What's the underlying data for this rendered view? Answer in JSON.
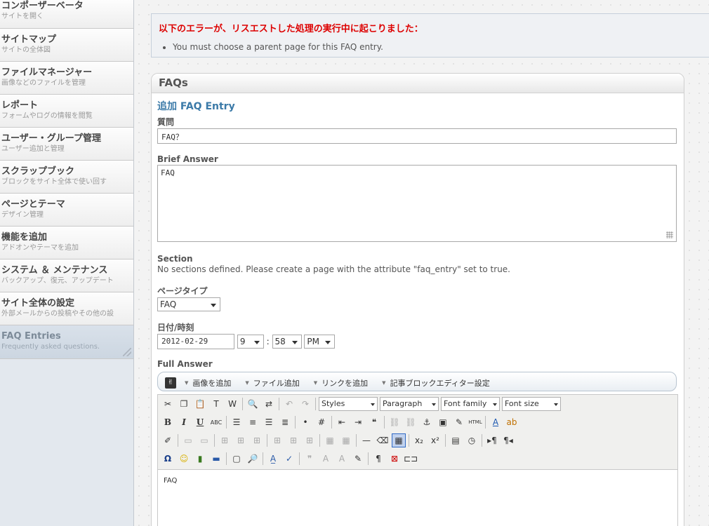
{
  "sidebar": {
    "items": [
      {
        "title": "コンポーザーベータ",
        "desc": "サイトを開く"
      },
      {
        "title": "サイトマップ",
        "desc": "サイトの全体図"
      },
      {
        "title": "ファイルマネージャー",
        "desc": "画像などのファイルを管理"
      },
      {
        "title": "レポート",
        "desc": "フォームやログの情報を閲覧"
      },
      {
        "title": "ユーザー・グループ管理",
        "desc": "ユーザー追加と管理"
      },
      {
        "title": "スクラップブック",
        "desc": "ブロックをサイト全体で使い回す"
      },
      {
        "title": "ページとテーマ",
        "desc": "デザイン管理"
      },
      {
        "title": "機能を追加",
        "desc": "アドオンやテーマを追加"
      },
      {
        "title": "システム ＆ メンテナンス",
        "desc": "バックアップ、復元、アップデート"
      },
      {
        "title": "サイト全体の設定",
        "desc": "外部メールからの投稿やその他の設"
      },
      {
        "title": "FAQ Entries",
        "desc": "Frequently asked questions."
      }
    ]
  },
  "error": {
    "title": "以下のエラーが、リスエストした処理の実行中に起こりました：",
    "messages": [
      "You must choose a parent page for this FAQ entry."
    ]
  },
  "panel": {
    "title": "FAQs",
    "heading": "追加 FAQ Entry"
  },
  "form": {
    "question_label": "質問",
    "question_value": "FAQ？",
    "brief_label": "Brief Answer",
    "brief_value": "FAQ",
    "section_label": "Section",
    "section_text": "No sections defined. Please create a page with the attribute \"faq_entry\" set to true.",
    "pagetype_label": "ページタイプ",
    "pagetype_value": "FAQ",
    "datetime_label": "日付/時刻",
    "date_value": "2012-02-29",
    "hour_value": "9",
    "time_sep": ":",
    "minute_value": "58",
    "ampm_value": "PM",
    "full_label": "Full Answer"
  },
  "mini_toolbar": {
    "logo": "✌",
    "add_image": "画像を追加",
    "add_file": "ファイル追加",
    "add_link": "リンクを追加",
    "editor_settings": "記事ブロックエディター設定"
  },
  "editor": {
    "styles": "Styles",
    "paragraph": "Paragraph",
    "font_family": "Font family",
    "font_size": "Font size",
    "content": "FAQ"
  }
}
